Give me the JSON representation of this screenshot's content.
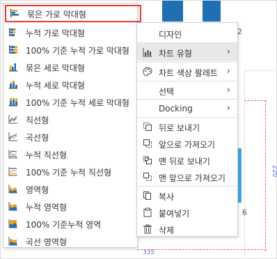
{
  "chart_type_menu": {
    "items": [
      {
        "label": "묶은 가로 막대형",
        "icon": "clustered-bar-icon",
        "selected": true
      },
      {
        "label": "누적 가로 막대형",
        "icon": "stacked-bar-icon"
      },
      {
        "label": "100% 기준 누적 가로 막대형",
        "icon": "stacked-bar-100-icon"
      },
      {
        "label": "묶은 세로 막대형",
        "icon": "clustered-column-icon"
      },
      {
        "label": "누적 세로 막대형",
        "icon": "stacked-column-icon"
      },
      {
        "label": "100% 기준 누적 세로 막대형",
        "icon": "stacked-column-100-icon"
      },
      {
        "label": "직선형",
        "icon": "line-chart-icon"
      },
      {
        "label": "곡선형",
        "icon": "spline-chart-icon"
      },
      {
        "label": "누적 직선형",
        "icon": "stacked-line-icon"
      },
      {
        "label": "100% 기준 누적 직선형",
        "icon": "stacked-line-100-icon"
      },
      {
        "label": "영역형",
        "icon": "area-chart-icon"
      },
      {
        "label": "누적 영역형",
        "icon": "stacked-area-icon"
      },
      {
        "label": "100% 기준누적 영역",
        "icon": "stacked-area-100-icon"
      },
      {
        "label": "곡선 영역형",
        "icon": "spline-area-icon"
      }
    ]
  },
  "context_menu": {
    "header": "디자인",
    "items": [
      {
        "label": "차트 유형",
        "icon": "bar-chart-icon",
        "submenu": true,
        "highlighted": true
      },
      {
        "label": "차트 색상 팔레트",
        "icon": "palette-icon",
        "submenu": true
      },
      {
        "label": "선택",
        "icon": "",
        "submenu": true
      },
      {
        "label": "Docking",
        "icon": "",
        "submenu": true
      },
      {
        "label": "뒤로 보내기",
        "icon": "send-backward-icon"
      },
      {
        "label": "앞으로 가져오기",
        "icon": "bring-forward-icon"
      },
      {
        "label": "맨 뒤로 보내기",
        "icon": "send-to-back-icon"
      },
      {
        "label": "맨 앞으로 가져오기",
        "icon": "bring-to-front-icon"
      },
      {
        "label": "복사",
        "icon": "copy-icon"
      },
      {
        "label": "붙여넣기",
        "icon": "paste-icon"
      },
      {
        "label": "삭제",
        "icon": "trash-icon"
      }
    ]
  },
  "background": {
    "tick_top": "2",
    "tick_right": "6",
    "width_label": "335",
    "height_label": "220"
  },
  "colors": {
    "highlight_border": "#e53935",
    "bar_dark": "#1f6fb2",
    "bar_light": "#3da9e0",
    "icon_orange": "#f0a020",
    "dash": "#e0607a"
  }
}
